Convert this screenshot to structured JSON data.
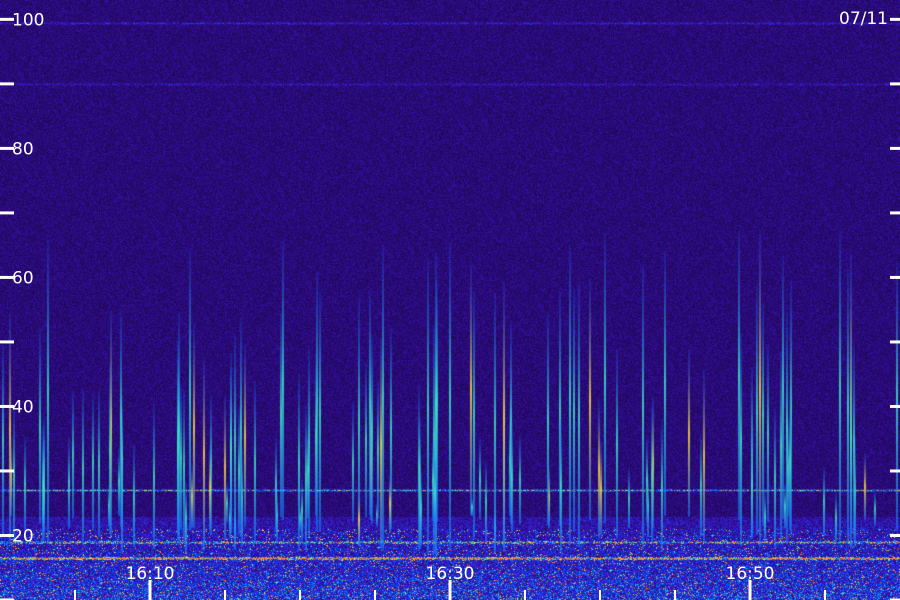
{
  "chart_data": {
    "type": "heatmap",
    "title": "",
    "date_label": "07/11",
    "y_ticks": [
      {
        "value": 10,
        "label": ""
      },
      {
        "value": 20,
        "label": "20"
      },
      {
        "value": 30,
        "label": ""
      },
      {
        "value": 40,
        "label": "40"
      },
      {
        "value": 50,
        "label": ""
      },
      {
        "value": 60,
        "label": "60"
      },
      {
        "value": 70,
        "label": ""
      },
      {
        "value": 80,
        "label": "80"
      },
      {
        "value": 90,
        "label": ""
      },
      {
        "value": 100,
        "label": "100"
      }
    ],
    "ylim": [
      10,
      103
    ],
    "x_minutes": [
      0,
      60
    ],
    "x_major_ticks": [
      {
        "minute": 10,
        "label": "16:10"
      },
      {
        "minute": 30,
        "label": "16:30"
      },
      {
        "minute": 50,
        "label": "16:50"
      }
    ],
    "x_minor_step_minutes": 5,
    "horizontal_bands": [
      {
        "freq": 27,
        "intensity": 0.5
      },
      {
        "freq": 16.5,
        "intensity": 0.55
      },
      {
        "freq": 19,
        "intensity": 0.35
      },
      {
        "freq": 90,
        "intensity": 0.15
      },
      {
        "freq": 99.5,
        "intensity": 0.2
      }
    ],
    "colors": {
      "background": "#22005a",
      "low": "#3a10a0",
      "mid": "#0060ff",
      "high": "#30e0d0",
      "peak": "#ffe040",
      "axis": "#ffffff"
    }
  }
}
